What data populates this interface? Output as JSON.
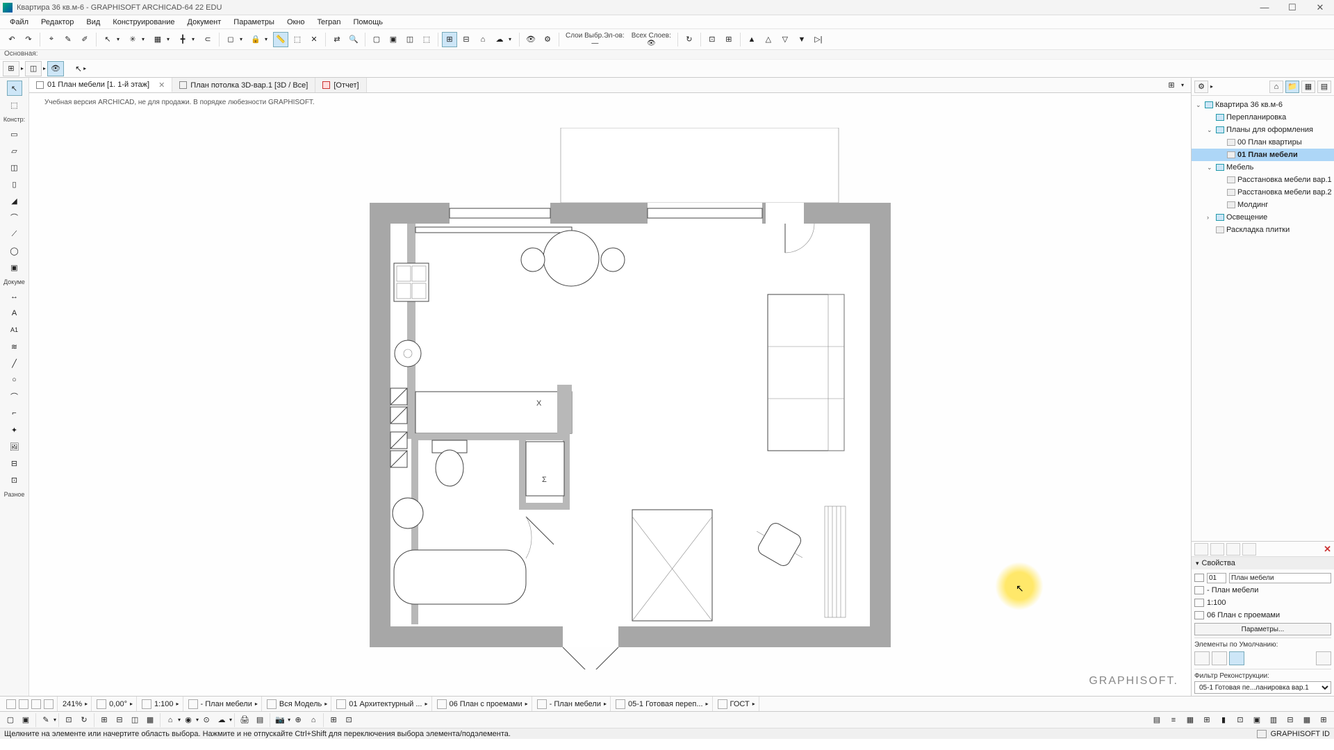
{
  "title": "Квартира 36 кв.м-6 - GRAPHISOFT ARCHICAD-64 22 EDU",
  "menu": [
    "Файл",
    "Редактор",
    "Вид",
    "Конструирование",
    "Документ",
    "Параметры",
    "Окно",
    "Teгрan",
    "Помощь"
  ],
  "infobar": "Основная:",
  "tabs": [
    {
      "label": "01 План мебели [1. 1-й этаж]",
      "active": true,
      "closable": true
    },
    {
      "label": "План потолка 3D-вар.1 [3D / Все]",
      "active": false
    },
    {
      "label": "[Отчет]",
      "active": false,
      "red": true
    }
  ],
  "watermark": "Учебная версия ARCHICAD, не для продажи. В порядке любезности GRAPHISOFT.",
  "brand": "GRAPHISOFT.",
  "toolbar_texts": {
    "layer_sel": "Слои Выбр.Эл-ов:",
    "layer_all": "Всех Слоев:"
  },
  "toolbox": {
    "section1": "Констр:",
    "section2": "Докуме",
    "section3": "Разное"
  },
  "navigator": {
    "tree": [
      {
        "label": "Квартира 36 кв.м-6",
        "indent": 0,
        "exp": "v",
        "icon": "home"
      },
      {
        "label": "Перепланировка",
        "indent": 1,
        "icon": "folder"
      },
      {
        "label": "Планы для оформления",
        "indent": 1,
        "exp": "v",
        "icon": "folder"
      },
      {
        "label": "00 План квартиры",
        "indent": 2,
        "icon": "doc"
      },
      {
        "label": "01 План мебели",
        "indent": 2,
        "icon": "doc",
        "sel": true
      },
      {
        "label": "Мебель",
        "indent": 1,
        "exp": "v",
        "icon": "folder"
      },
      {
        "label": "Расстановка мебели вар.1",
        "indent": 2,
        "icon": "doc"
      },
      {
        "label": "Расстановка мебели вар.2",
        "indent": 2,
        "icon": "doc"
      },
      {
        "label": "Молдинг",
        "indent": 2,
        "icon": "doc"
      },
      {
        "label": "Освещение",
        "indent": 1,
        "exp": ">",
        "icon": "folder"
      },
      {
        "label": "Раскладка плитки",
        "indent": 1,
        "icon": "doc"
      }
    ]
  },
  "properties": {
    "title": "Свойства",
    "id": "01",
    "name": "План мебели",
    "layer_name": "- План мебели",
    "scale": "1:100",
    "template": "06 План с проемами",
    "params_btn": "Параметры...",
    "defaults_label": "Элементы по Умолчанию:",
    "filter_label": "Фильтр Реконструкции:",
    "filter_value": "05-1 Готовая пе...ланировка вар.1"
  },
  "statusbar": {
    "zoom": "241%",
    "angle": "0,00°",
    "scale": "1:100",
    "layer_combo": "- План мебели",
    "model": "Вся Модель",
    "arch": "01 Архитектурный ...",
    "plan": "06 План с проемами",
    "furn": "- План мебели",
    "ready": "05-1 Готовая переп...",
    "gost": "ГОСТ"
  },
  "hint": "Щелкните на элементе или начертите область выбора. Нажмите и не отпускайте Ctrl+Shift для переключения выбора элемента/подэлемента.",
  "hint_right": "GRAPHISOFT ID",
  "floorplan": {
    "door_marker": "X",
    "bath_marker": "Σ"
  }
}
